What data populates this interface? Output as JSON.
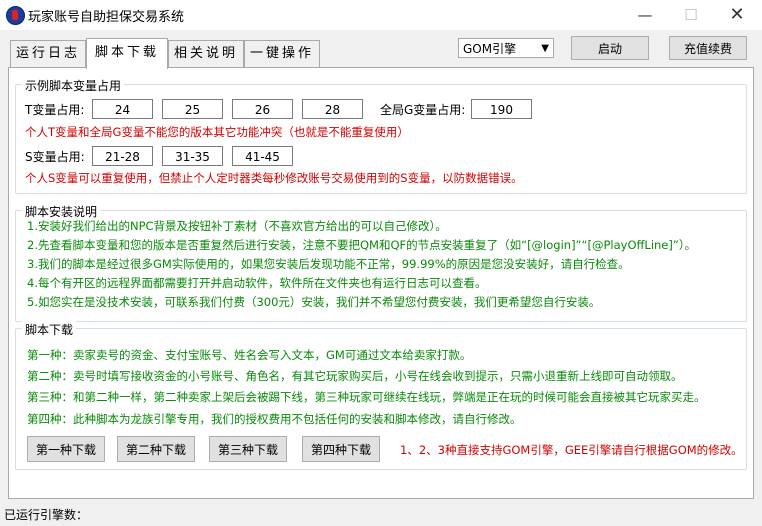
{
  "window": {
    "title": "玩家账号自助担保交易系统",
    "minimize": "—",
    "maximize": "☐",
    "close": "✕"
  },
  "tabs": [
    {
      "label": "运行日志"
    },
    {
      "label": "脚本下载"
    },
    {
      "label": "相关说明"
    },
    {
      "label": "一键操作"
    }
  ],
  "engine_select": {
    "value": "GOM引擎"
  },
  "buttons": {
    "start": "启动",
    "recharge": "充值续费"
  },
  "example_group": {
    "title": "示例脚本变量占用",
    "t_label": "T变量占用:",
    "t_values": [
      "24",
      "25",
      "26",
      "28"
    ],
    "global_label": "全局G变量占用:",
    "global_value": "190",
    "t_note": "个人T变量和全局G变量不能您的版本其它功能冲突（也就是不能重复使用）",
    "s_label": "S变量占用:",
    "s_values": [
      "21-28",
      "31-35",
      "41-45"
    ],
    "s_note": "个人S变量可以重复使用，但禁止个人定时器类每秒修改账号交易使用到的S变量，以防数据错误。"
  },
  "install_group": {
    "title": "脚本安装说明",
    "lines": [
      "1.安装好我们给出的NPC背景及按钮补丁素材（不喜欢官方给出的可以自己修改）。",
      "2.先查看脚本变量和您的版本是否重复然后进行安装，注意不要把QM和QF的节点安装重复了（如“[@login]”“[@PlayOffLine]”）。",
      "3.我们的脚本是经过很多GM实际使用的，如果您安装后发现功能不正常，99.99%的原因是您没安装好，请自行检查。",
      "4.每个有开区的远程界面都需要打开并启动软件，软件所在文件夹也有运行日志可以查看。",
      "5.如您实在是没技术安装，可联系我们付费（300元）安装，我们并不希望您付费安装，我们更希望您自行安装。"
    ]
  },
  "download_group": {
    "title": "脚本下载",
    "lines": [
      "第一种：卖家卖号的资金、支付宝账号、姓名会写入文本，GM可通过文本给卖家打款。",
      "第二种：卖号时填写接收资金的小号账号、角色名，有其它玩家购买后，小号在线会收到提示，只需小退重新上线即可自动领取。",
      "第三种：和第二种一样，第二种卖家上架后会被踢下线，第三种玩家可继续在线玩，弊端是正在玩的时候可能会直接被其它玩家买走。",
      "第四种：此种脚本为龙族引擎专用，我们的授权费用不包括任何的安装和脚本修改，请自行修改。"
    ],
    "buttons": [
      "第一种下载",
      "第二种下载",
      "第三种下载",
      "第四种下载"
    ],
    "note": "1、2、3种直接支持GOM引擎，GEE引擎请自行根据GOM的修改。"
  },
  "status": {
    "text": "已运行引擎数："
  }
}
